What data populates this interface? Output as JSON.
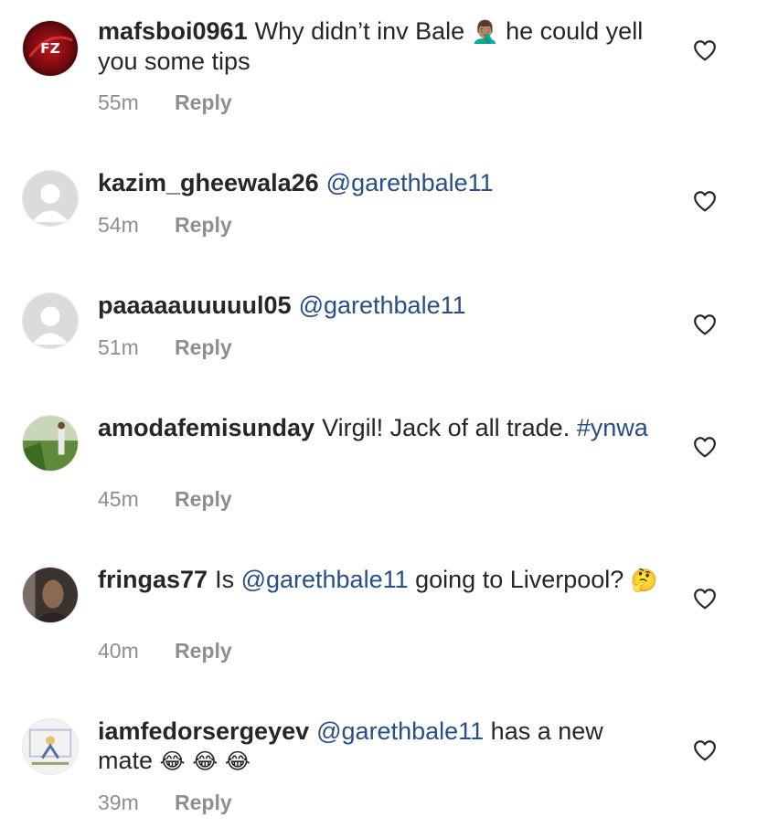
{
  "comments": [
    {
      "username": "mafsboi0961",
      "parts": [
        {
          "t": "text",
          "v": "Why didn’t inv Bale "
        },
        {
          "t": "emoji",
          "v": "🤦🏽‍♂️"
        },
        {
          "t": "text",
          "v": " he could yell you some tips"
        }
      ],
      "time": "55m",
      "reply": "Reply",
      "avatar": "faze-logo"
    },
    {
      "username": "kazim_gheewala26",
      "parts": [
        {
          "t": "mention",
          "v": "@garethbale11"
        }
      ],
      "time": "54m",
      "reply": "Reply",
      "avatar": "default"
    },
    {
      "username": "paaaaauuuuul05",
      "parts": [
        {
          "t": "mention",
          "v": "@garethbale11"
        }
      ],
      "time": "51m",
      "reply": "Reply",
      "avatar": "default"
    },
    {
      "username": "amodafemisunday",
      "parts": [
        {
          "t": "text",
          "v": "Virgil! Jack of all trade. "
        },
        {
          "t": "hashtag",
          "v": "#ynwa"
        }
      ],
      "time": "45m",
      "reply": "Reply",
      "avatar": "photo-garden"
    },
    {
      "username": "fringas77",
      "parts": [
        {
          "t": "text",
          "v": "Is "
        },
        {
          "t": "mention",
          "v": "@garethbale11"
        },
        {
          "t": "text",
          "v": " going to Liverpool? "
        },
        {
          "t": "emoji",
          "v": "🤔"
        }
      ],
      "time": "40m",
      "reply": "Reply",
      "avatar": "photo-portrait"
    },
    {
      "username": "iamfedorsergeyev",
      "parts": [
        {
          "t": "mention",
          "v": "@garethbale11"
        },
        {
          "t": "text",
          "v": " has a new mate "
        },
        {
          "t": "emoji",
          "v": "😂 😂 😂"
        }
      ],
      "time": "39m",
      "reply": "Reply",
      "avatar": "photo-drawing"
    }
  ],
  "colors": {
    "mention": "#274e88",
    "meta": "#8e8e8e",
    "text": "#262626"
  },
  "icons": {
    "like": "heart-outline-icon"
  }
}
